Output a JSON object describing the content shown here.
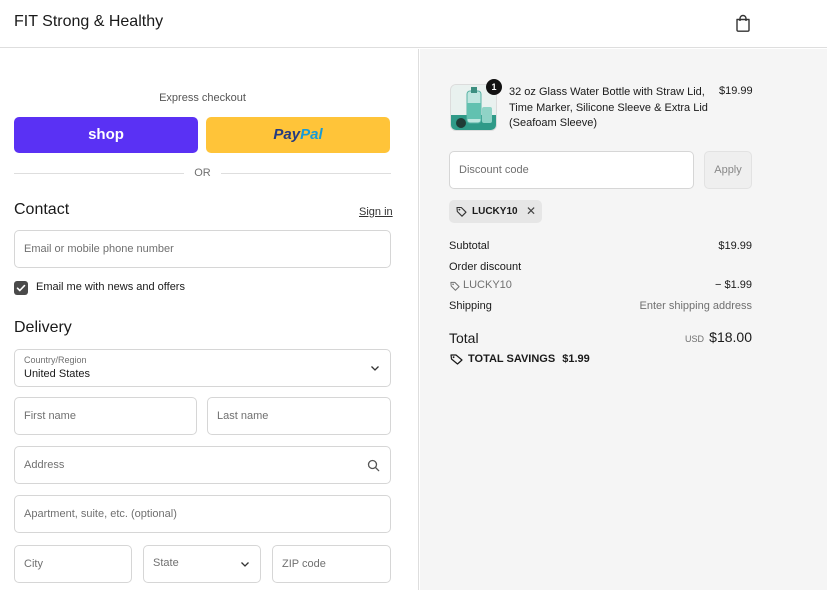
{
  "header": {
    "brand": "FIT Strong & Healthy",
    "cart_icon": "shopping-bag-icon"
  },
  "express": {
    "label": "Express checkout",
    "shop_label": "shop",
    "paypal_part1": "Pay",
    "paypal_part2": "Pal",
    "or_label": "OR",
    "shop_color": "#5a31f4",
    "paypal_color": "#ffc439"
  },
  "contact": {
    "title": "Contact",
    "sign_in": "Sign in",
    "email_placeholder": "Email or mobile phone number",
    "marketing_label": "Email me with news and offers",
    "marketing_checked": true
  },
  "delivery": {
    "title": "Delivery",
    "country_label": "Country/Region",
    "country_value": "United States",
    "first_name_placeholder": "First name",
    "last_name_placeholder": "Last name",
    "address_placeholder": "Address",
    "apartment_placeholder": "Apartment, suite, etc. (optional)",
    "city_placeholder": "City",
    "state_placeholder": "State",
    "zip_placeholder": "ZIP code"
  },
  "summary": {
    "product": {
      "quantity": "1",
      "name": "32 oz Glass Water Bottle with Straw Lid, Time Marker, Silicone Sleeve & Extra Lid (Seafoam Sleeve)",
      "price": "$19.99"
    },
    "discount_placeholder": "Discount code",
    "apply_label": "Apply",
    "applied_code": "LUCKY10",
    "remove_symbol": "✕",
    "subtotal_label": "Subtotal",
    "subtotal_value": "$19.99",
    "order_discount_label": "Order discount",
    "discount_code": "LUCKY10",
    "discount_value": "− $1.99",
    "shipping_label": "Shipping",
    "shipping_value": "Enter shipping address",
    "total_label": "Total",
    "currency": "USD",
    "total_value": "$18.00",
    "savings_label": "TOTAL SAVINGS",
    "savings_value": "$1.99"
  }
}
